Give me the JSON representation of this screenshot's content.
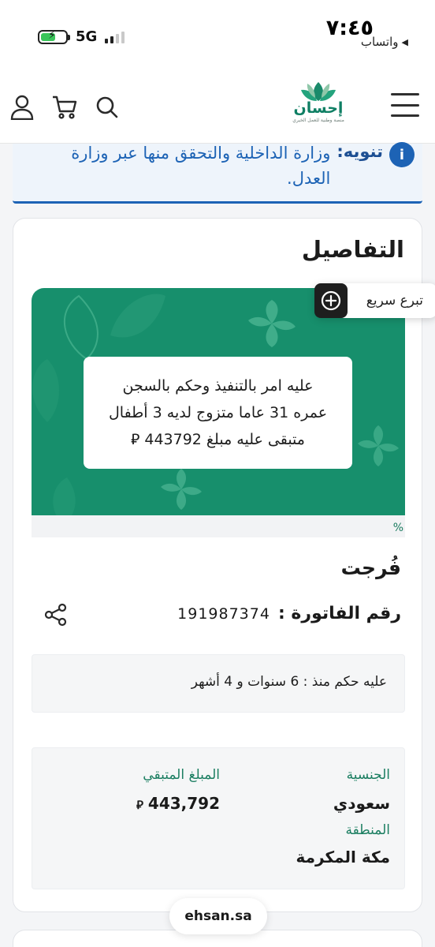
{
  "status_bar": {
    "time": "٧:٤٥",
    "back_label": "واتساب",
    "network": "5G",
    "back_icon": "triangle-back-icon",
    "battery_icon": "battery-charging-icon",
    "signal_icon": "signal-bars-icon"
  },
  "navbar": {
    "logo_name": "إحسان",
    "logo_tagline": "منصة وطنية للعمل الخيري",
    "icons": [
      "menu-icon",
      "search-icon",
      "cart-icon",
      "user-icon"
    ]
  },
  "notice": {
    "label": "تنويه:",
    "text": "وزارة الداخلية والتحقق منها عبر وزارة العدل.",
    "icon": "info-icon",
    "color": "#1d63b5"
  },
  "details": {
    "title": "التفاصيل",
    "quick_donate": "تبرع سريع",
    "hero_lines": [
      "عليه امر بالتنفيذ وحكم بالسجن",
      "عمره 31 عاما متزوج لديه 3 أطفال",
      "متبقى عليه مبلغ 443792 ⃁"
    ],
    "hero_badge": "%",
    "case_title": "فُرجت",
    "invoice_label": "رقم الفاتورة :",
    "invoice_value": "191987374",
    "sentence": "عليه حكم منذ : 6 سنوات و 4 أشهر",
    "nationality_label": "الجنسية",
    "nationality_value": "سعودي",
    "remaining_label": "المبلغ المتبقي",
    "remaining_value": "443,792",
    "currency": "⃁",
    "region_label": "المنطقة",
    "region_value": "مكة المكرمة",
    "accent": "#178f6c"
  },
  "footer": {
    "url": "ehsan.sa"
  }
}
